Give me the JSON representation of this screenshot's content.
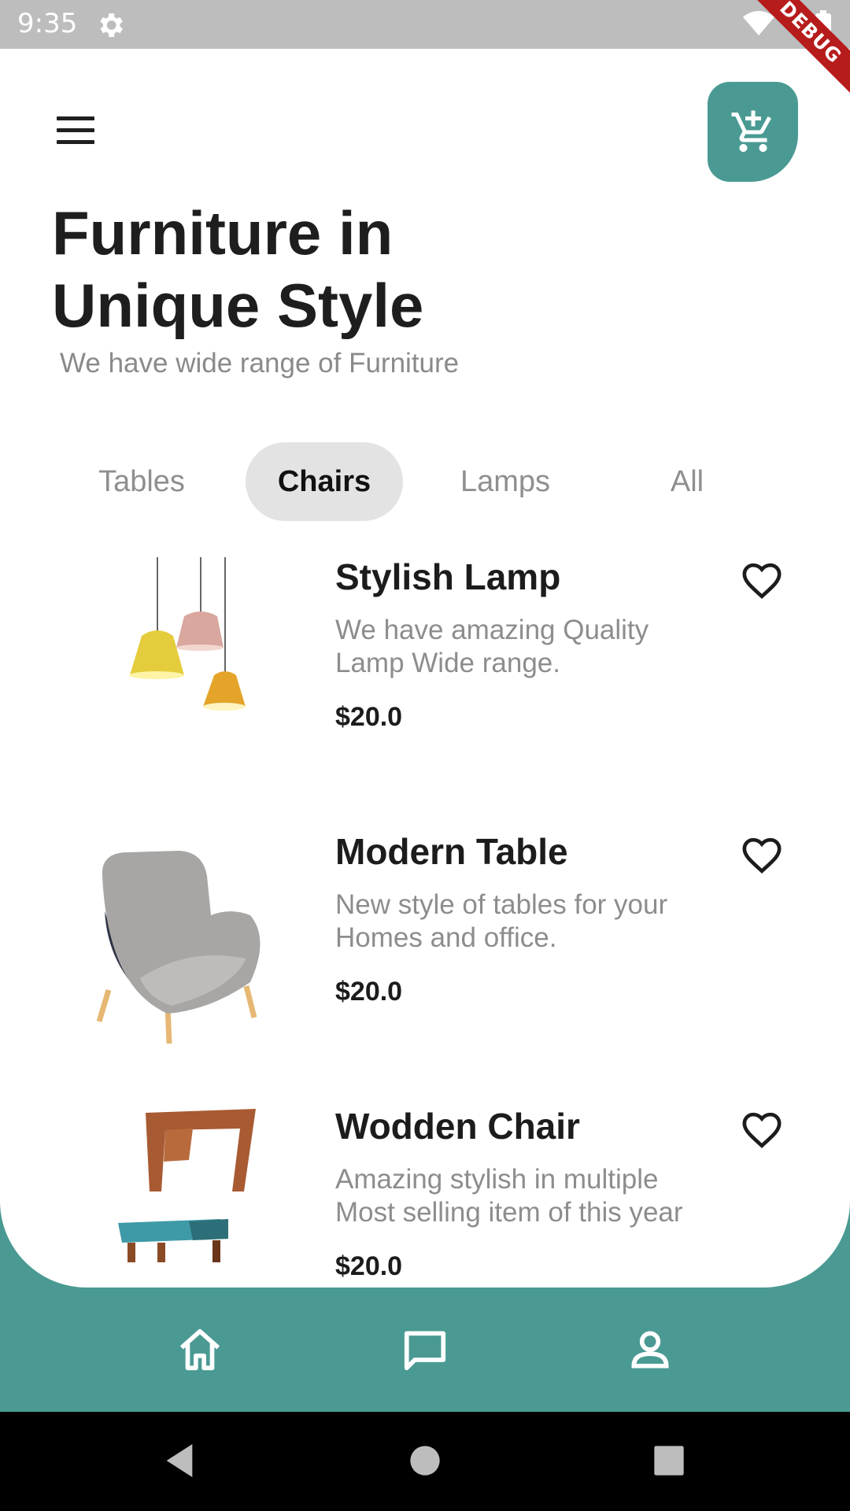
{
  "status_bar": {
    "time": "9:35",
    "debug_label": "DEBUG"
  },
  "header": {
    "title_line1": "Furniture in",
    "title_line2": "Unique Style",
    "subtitle": "We have wide range of Furniture"
  },
  "tabs": [
    {
      "label": "Tables",
      "active": false
    },
    {
      "label": "Chairs",
      "active": true
    },
    {
      "label": "Lamps",
      "active": false
    },
    {
      "label": "All",
      "active": false
    }
  ],
  "products": [
    {
      "name": "Stylish Lamp",
      "description": "We have amazing Quality Lamp Wide range.",
      "price": "$20.0",
      "image": "pendant-lamps-image"
    },
    {
      "name": "Modern Table",
      "description": "New style of tables for your Homes and office.",
      "price": "$20.0",
      "image": "armchair-image"
    },
    {
      "name": "Wodden Chair",
      "description": "Amazing stylish in multiple Most selling item of this year",
      "price": "$20.0",
      "image": "wooden-chair-image"
    }
  ],
  "bottom_nav": [
    {
      "icon": "home-icon"
    },
    {
      "icon": "chat-icon"
    },
    {
      "icon": "profile-icon"
    }
  ],
  "colors": {
    "accent": "#4a9a93",
    "status_bar": "#bdbdbd",
    "debug_ribbon": "#b71c1c",
    "active_tab_bg": "#e3e3e3"
  }
}
